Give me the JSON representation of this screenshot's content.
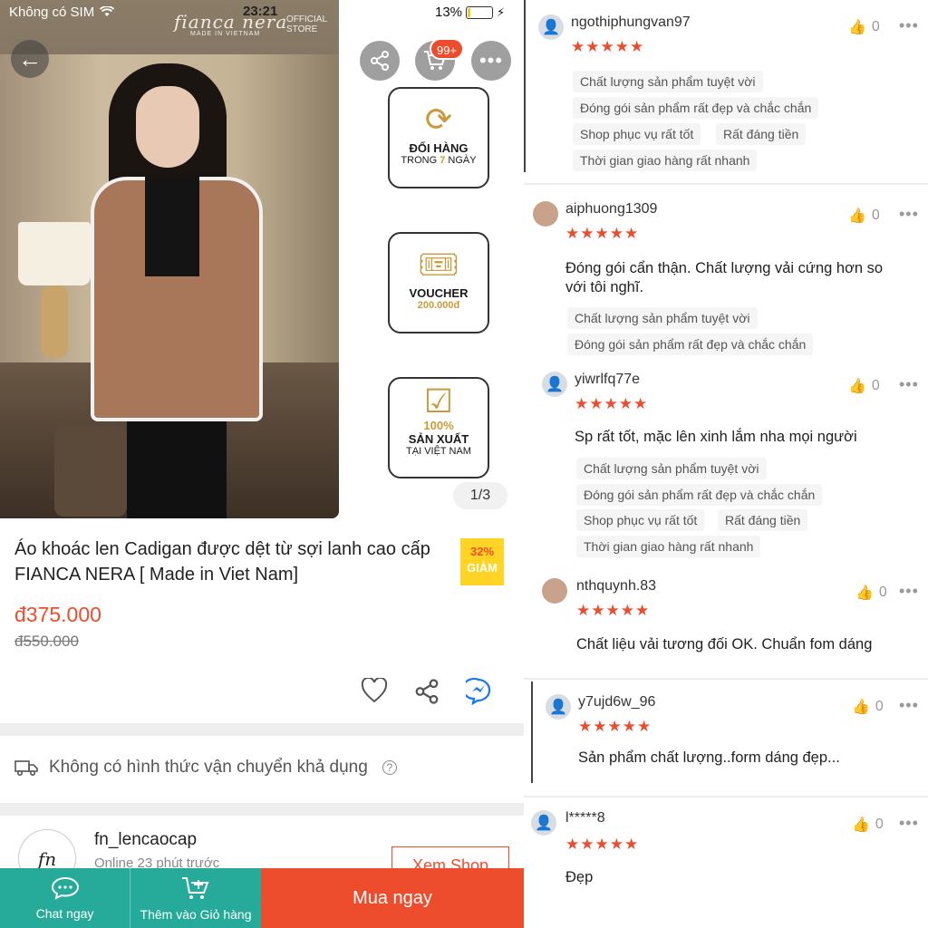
{
  "status": {
    "carrier": "Không có SIM",
    "time": "23:21",
    "battery": "13%",
    "battery_level": 0.13
  },
  "hero": {
    "brand": "fianca nera",
    "brand_sub": "MADE IN VIETNAM",
    "store_tag": "OFFICIAL STORE",
    "cart_badge": "99+",
    "image_counter": "1/3",
    "promos": [
      {
        "icon": "exchange-box-icon",
        "main": "ĐỔI HÀNG",
        "sub_prefix": "TRONG ",
        "sub_highlight": "7",
        "sub_suffix": " NGÀY"
      },
      {
        "icon": "voucher-icon",
        "main": "VOUCHER",
        "sub": "200.000đ"
      },
      {
        "icon": "check-badge-icon",
        "highlight": "100%",
        "main": "SẢN XUẤT",
        "sub": "TẠI VIỆT NAM"
      }
    ]
  },
  "product": {
    "title": "Áo khoác len Cadigan được dệt từ sợi lanh cao cấp FIANCA NERA [ Made in Viet Nam]",
    "discount_pct": "32%",
    "discount_word": "GIẢM",
    "price": "đ375.000",
    "original_price": "đ550.000"
  },
  "shipping": {
    "text": "Không có hình thức vận chuyển khả dụng"
  },
  "shop": {
    "logo_text": "fn",
    "name": "fn_lencaocap",
    "online": "Online 23 phút trước",
    "view_label": "Xem Shop"
  },
  "bottom_bar": {
    "chat_label": "Chat ngay",
    "cart_label": "Thêm vào Giỏ hàng",
    "buy_label": "Mua ngay"
  },
  "reviews": [
    {
      "user": "ngothiphungvan97",
      "rating": 5,
      "likes": "0",
      "text": "",
      "tags": [
        "Chất lượng sản phẩm tuyệt vời",
        "Đóng gói sản phẩm rất đẹp và chắc chắn",
        "Shop phục vụ rất tốt",
        "Rất đáng tiền",
        "Thời gian giao hàng rất nhanh"
      ]
    },
    {
      "user": "aiphuong1309",
      "rating": 5,
      "likes": "0",
      "text": "Đóng gói cẩn thận. Chất lượng vải cứng hơn so với tôi nghĩ.",
      "tags": [
        "Chất lượng sản phẩm tuyệt vời",
        "Đóng gói sản phẩm rất đẹp và chắc chắn"
      ]
    },
    {
      "user": "yiwrlfq77e",
      "rating": 5,
      "likes": "0",
      "text": "Sp rất tốt, mặc lên xinh lắm nha mọi người",
      "tags": [
        "Chất lượng sản phẩm tuyệt vời",
        "Đóng gói sản phẩm rất đẹp và chắc chắn",
        "Shop phục vụ rất tốt",
        "Rất đáng tiền",
        "Thời gian giao hàng rất nhanh"
      ]
    },
    {
      "user": "nthquynh.83",
      "rating": 5,
      "likes": "0",
      "text": "Chất liệu vải tương đối OK. Chuẩn fom dáng",
      "tags": []
    },
    {
      "user": "y7ujd6w_96",
      "rating": 5,
      "likes": "0",
      "text": "Sản phẩm chất lượng..form dáng đẹp...",
      "tags": []
    },
    {
      "user": "l*****8",
      "rating": 5,
      "likes": "0",
      "text": "Đẹp",
      "tags": []
    }
  ],
  "colors": {
    "accent": "#ee4d2d",
    "teal": "#26aa99",
    "badge_yellow": "#ffd424"
  }
}
